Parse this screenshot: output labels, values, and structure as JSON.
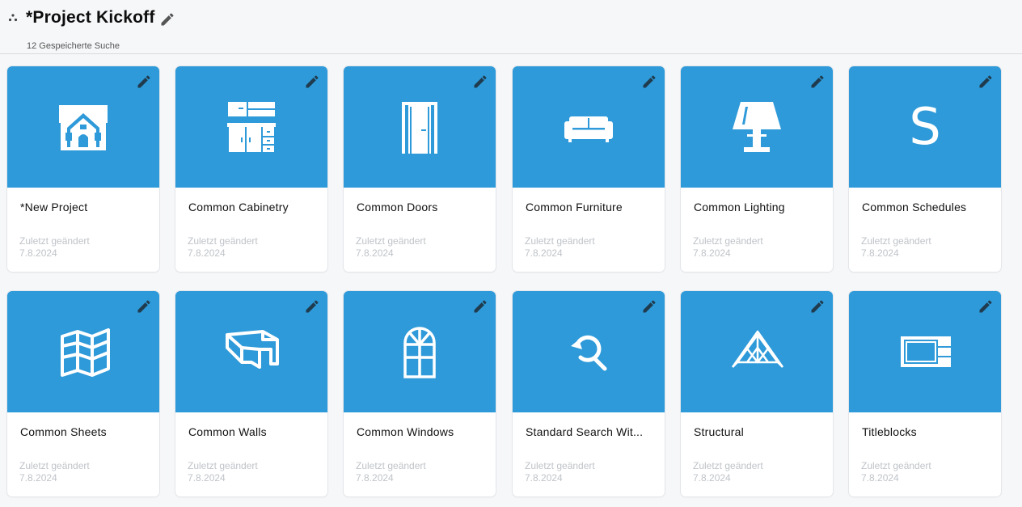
{
  "header": {
    "title": "*Project Kickoff",
    "subtitle": "12 Gespeicherte Suche",
    "title_edit_icon": "pencil-icon",
    "drag_icon": "drag-dots-icon"
  },
  "colors": {
    "accent": "#2e9ad9",
    "muted_text": "#bfc3c8"
  },
  "cards": [
    {
      "name": "*New Project",
      "modified_label": "Zuletzt geändert",
      "modified_date": "7.8.2024",
      "icon": "house-icon"
    },
    {
      "name": "Common Cabinetry",
      "modified_label": "Zuletzt geändert",
      "modified_date": "7.8.2024",
      "icon": "cabinet-icon"
    },
    {
      "name": "Common Doors",
      "modified_label": "Zuletzt geändert",
      "modified_date": "7.8.2024",
      "icon": "door-icon"
    },
    {
      "name": "Common Furniture",
      "modified_label": "Zuletzt geändert",
      "modified_date": "7.8.2024",
      "icon": "sofa-icon"
    },
    {
      "name": "Common Lighting",
      "modified_label": "Zuletzt geändert",
      "modified_date": "7.8.2024",
      "icon": "lamp-icon"
    },
    {
      "name": "Common Schedules",
      "modified_label": "Zuletzt geändert",
      "modified_date": "7.8.2024",
      "icon": "schedule-s-icon",
      "glyph": "S"
    },
    {
      "name": "Common Sheets",
      "modified_label": "Zuletzt geändert",
      "modified_date": "7.8.2024",
      "icon": "sheets-map-icon"
    },
    {
      "name": "Common Walls",
      "modified_label": "Zuletzt geändert",
      "modified_date": "7.8.2024",
      "icon": "walls-icon"
    },
    {
      "name": "Common Windows",
      "modified_label": "Zuletzt geändert",
      "modified_date": "7.8.2024",
      "icon": "window-icon"
    },
    {
      "name": "Standard Search Wit...",
      "modified_label": "Zuletzt geändert",
      "modified_date": "7.8.2024",
      "icon": "search-refresh-icon"
    },
    {
      "name": "Structural",
      "modified_label": "Zuletzt geändert",
      "modified_date": "7.8.2024",
      "icon": "truss-icon"
    },
    {
      "name": "Titleblocks",
      "modified_label": "Zuletzt geändert",
      "modified_date": "7.8.2024",
      "icon": "titleblock-icon"
    }
  ]
}
